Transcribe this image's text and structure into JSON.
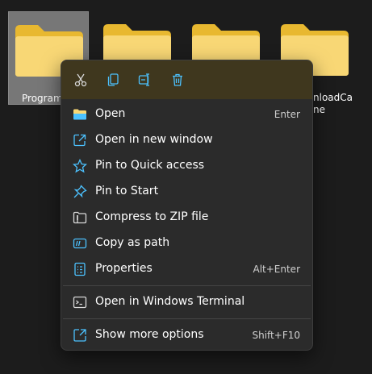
{
  "folders": [
    {
      "label": "Program",
      "selected": true
    },
    {
      "label": "",
      "selected": false
    },
    {
      "label": "",
      "selected": false
    },
    {
      "label": "nloadCa\nne",
      "selected": false
    }
  ],
  "toolbar": {
    "cut_icon": "scissors-icon",
    "copy_icon": "copy-icon",
    "rename_icon": "rename-icon",
    "delete_icon": "trash-icon"
  },
  "menu": {
    "items": [
      {
        "label": "Open",
        "shortcut": "Enter",
        "icon": "folder-open-icon"
      },
      {
        "label": "Open in new window",
        "shortcut": "",
        "icon": "external-window-icon"
      },
      {
        "label": "Pin to Quick access",
        "shortcut": "",
        "icon": "star-icon"
      },
      {
        "label": "Pin to Start",
        "shortcut": "",
        "icon": "pin-icon"
      },
      {
        "label": "Compress to ZIP file",
        "shortcut": "",
        "icon": "zip-folder-icon"
      },
      {
        "label": "Copy as path",
        "shortcut": "",
        "icon": "copy-path-icon"
      },
      {
        "label": "Properties",
        "shortcut": "Alt+Enter",
        "icon": "properties-icon"
      }
    ],
    "terminal": {
      "label": "Open in Windows Terminal",
      "shortcut": "",
      "icon": "terminal-icon"
    },
    "more": {
      "label": "Show more options",
      "shortcut": "Shift+F10",
      "icon": "show-more-icon"
    }
  },
  "colors": {
    "accent": "#4cc2ff",
    "folder": "#f8d775",
    "menu_bg": "#2b2b2b"
  }
}
